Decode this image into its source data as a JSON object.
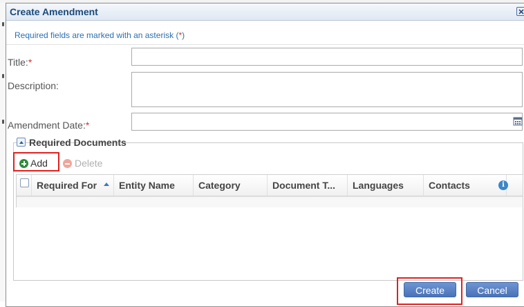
{
  "dialog": {
    "title": "Create Amendment",
    "close_icon": "close-icon"
  },
  "required_note": {
    "text": "Required fields are marked with an asterisk (",
    "asterisk": "*",
    "close": ")"
  },
  "form": {
    "title_label": "Title:",
    "title_value": "",
    "description_label": "Description:",
    "description_value": "",
    "amendment_date_label": "Amendment Date:",
    "amendment_date_value": "",
    "required_marker": "*"
  },
  "required_documents": {
    "legend": "Required Documents",
    "toolbar": {
      "add_label": "Add",
      "delete_label": "Delete"
    },
    "columns": [
      "Required For",
      "Entity Name",
      "Category",
      "Document T...",
      "Languages",
      "Contacts"
    ],
    "sort_column": "Required For",
    "sort_direction": "ascending",
    "rows": []
  },
  "footer": {
    "create_label": "Create",
    "cancel_label": "Cancel"
  },
  "colors": {
    "accent": "#4a72b6",
    "title": "#1a4a7a",
    "asterisk": "#d0332e",
    "highlight": "#e0201e",
    "add_icon": "#2f8a3c",
    "delete_icon": "#f0a59b"
  },
  "icons": [
    "close-icon",
    "calendar-icon",
    "collapse-icon",
    "add-icon",
    "delete-icon",
    "sort-asc-icon",
    "info-icon"
  ]
}
